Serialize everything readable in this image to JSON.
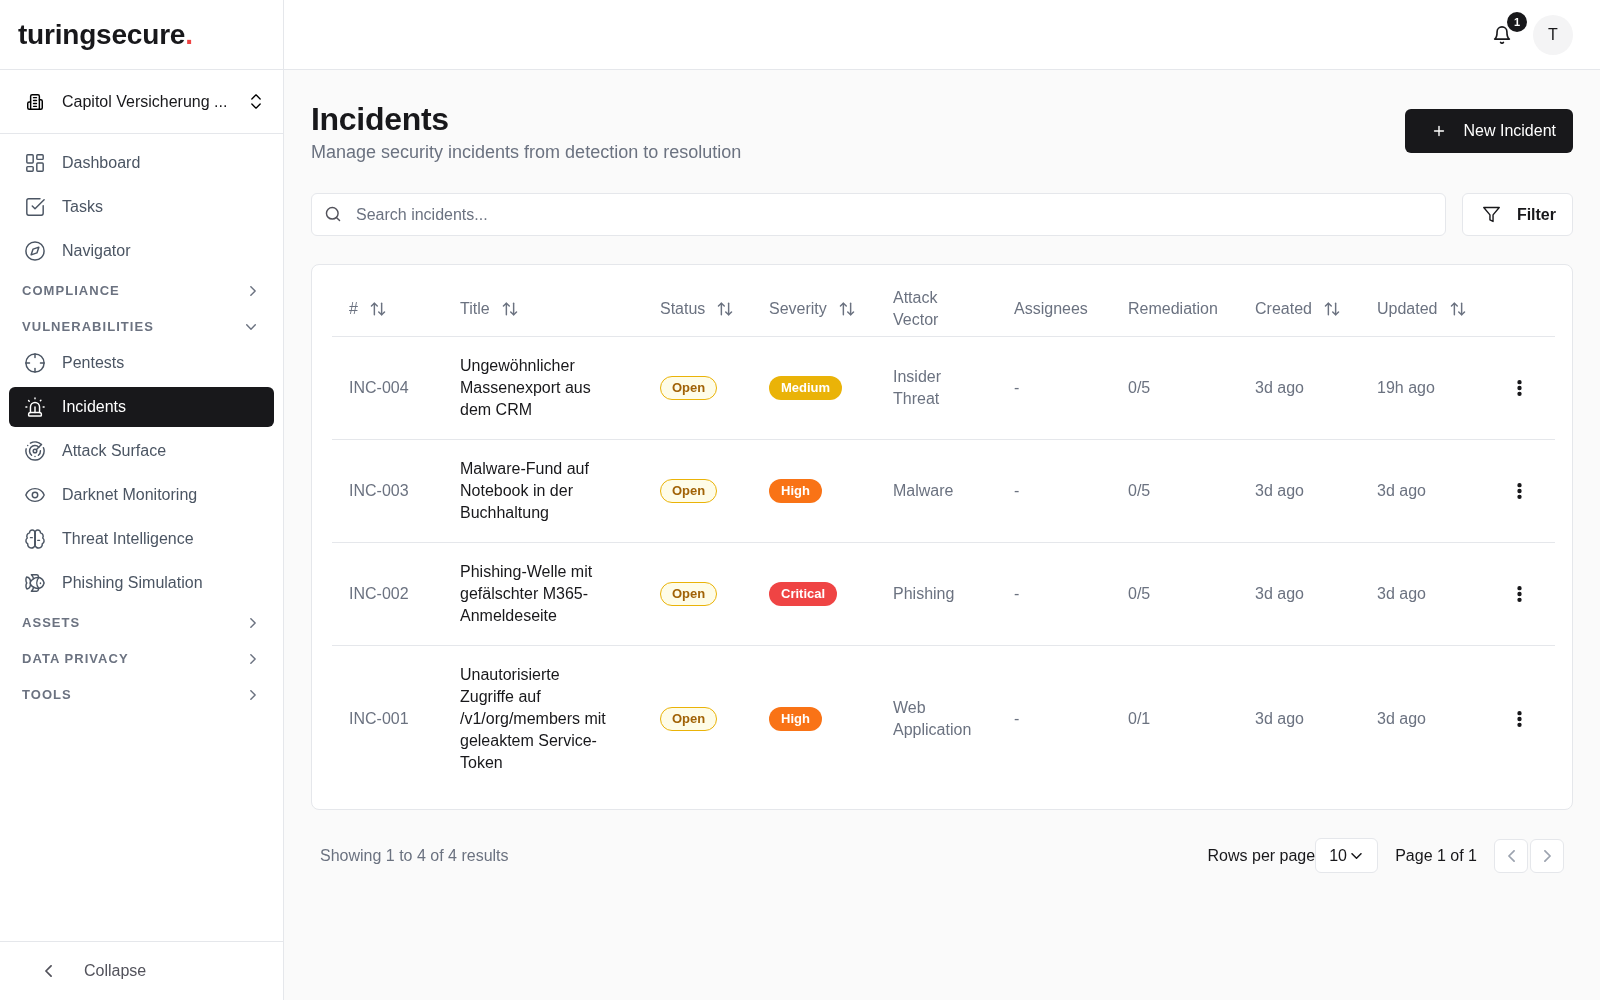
{
  "sidebar": {
    "logo": {
      "text": "turingsecure",
      "accent": "."
    },
    "workspace": {
      "label": "Capitol Versicherung ..."
    },
    "nav": [
      {
        "kind": "link",
        "label": "Dashboard",
        "selected": false
      },
      {
        "kind": "link",
        "label": "Tasks",
        "selected": false
      },
      {
        "kind": "link",
        "label": "Navigator",
        "selected": false
      },
      {
        "kind": "section",
        "label": "COMPLIANCE",
        "expanded": false
      },
      {
        "kind": "section",
        "label": "VULNERABILITIES",
        "expanded": true,
        "children": [
          {
            "kind": "link",
            "label": "Pentests",
            "selected": false
          },
          {
            "kind": "link",
            "label": "Incidents",
            "selected": true
          },
          {
            "kind": "link",
            "label": "Attack Surface",
            "selected": false
          },
          {
            "kind": "link",
            "label": "Darknet Monitoring",
            "selected": false
          },
          {
            "kind": "link",
            "label": "Threat Intelligence",
            "selected": false
          },
          {
            "kind": "link",
            "label": "Phishing Simulation",
            "selected": false
          }
        ]
      },
      {
        "kind": "section",
        "label": "ASSETS",
        "expanded": false
      },
      {
        "kind": "section",
        "label": "DATA PRIVACY",
        "expanded": false
      },
      {
        "kind": "section",
        "label": "TOOLS",
        "expanded": false
      }
    ],
    "collapse": {
      "label": "Collapse"
    }
  },
  "topbar": {
    "notifications": {
      "count": "1"
    },
    "avatar": {
      "initial": "T"
    }
  },
  "page": {
    "title": "Incidents",
    "subtitle": "Manage security incidents from detection to resolution",
    "new_button": "New Incident",
    "search": {
      "placeholder": "Search incidents..."
    },
    "filter_button": "Filter"
  },
  "table": {
    "columns": [
      {
        "label": "#",
        "sortable": true
      },
      {
        "label": "Title",
        "sortable": true
      },
      {
        "label": "Status",
        "sortable": true
      },
      {
        "label": "Severity",
        "sortable": true
      },
      {
        "label": "Attack Vector",
        "sortable": false
      },
      {
        "label": "Assignees",
        "sortable": false
      },
      {
        "label": "Remediation",
        "sortable": false
      },
      {
        "label": "Created",
        "sortable": true
      },
      {
        "label": "Updated",
        "sortable": true
      }
    ],
    "rows": [
      {
        "id": "INC-004",
        "title": "Ungewöhnlicher Massenexport aus dem CRM",
        "status": "Open",
        "severity": {
          "label": "Medium",
          "color": "#eab308"
        },
        "attack_vector": "Insider Threat",
        "assignees": "-",
        "remediation": "0/5",
        "created": "3d ago",
        "updated": "19h ago"
      },
      {
        "id": "INC-003",
        "title": "Malware-Fund auf Notebook in der Buchhaltung",
        "status": "Open",
        "severity": {
          "label": "High",
          "color": "#f97316"
        },
        "attack_vector": "Malware",
        "assignees": "-",
        "remediation": "0/5",
        "created": "3d ago",
        "updated": "3d ago"
      },
      {
        "id": "INC-002",
        "title": "Phishing-Welle mit gefälschter M365-Anmeldeseite",
        "status": "Open",
        "severity": {
          "label": "Critical",
          "color": "#ef4444"
        },
        "attack_vector": "Phishing",
        "assignees": "-",
        "remediation": "0/5",
        "created": "3d ago",
        "updated": "3d ago"
      },
      {
        "id": "INC-001",
        "title": "Unautorisierte Zugriffe auf /v1/org/members mit geleaktem Service-Token",
        "status": "Open",
        "severity": {
          "label": "High",
          "color": "#f97316"
        },
        "attack_vector": "Web Application",
        "assignees": "-",
        "remediation": "0/1",
        "created": "3d ago",
        "updated": "3d ago"
      }
    ]
  },
  "footer": {
    "summary": "Showing 1 to 4 of 4 results",
    "rows_per_page": {
      "label": "Rows per page",
      "value": "10"
    },
    "page_info": "Page 1 of 1",
    "prev": {
      "disabled": true
    },
    "next": {
      "disabled": true
    }
  }
}
